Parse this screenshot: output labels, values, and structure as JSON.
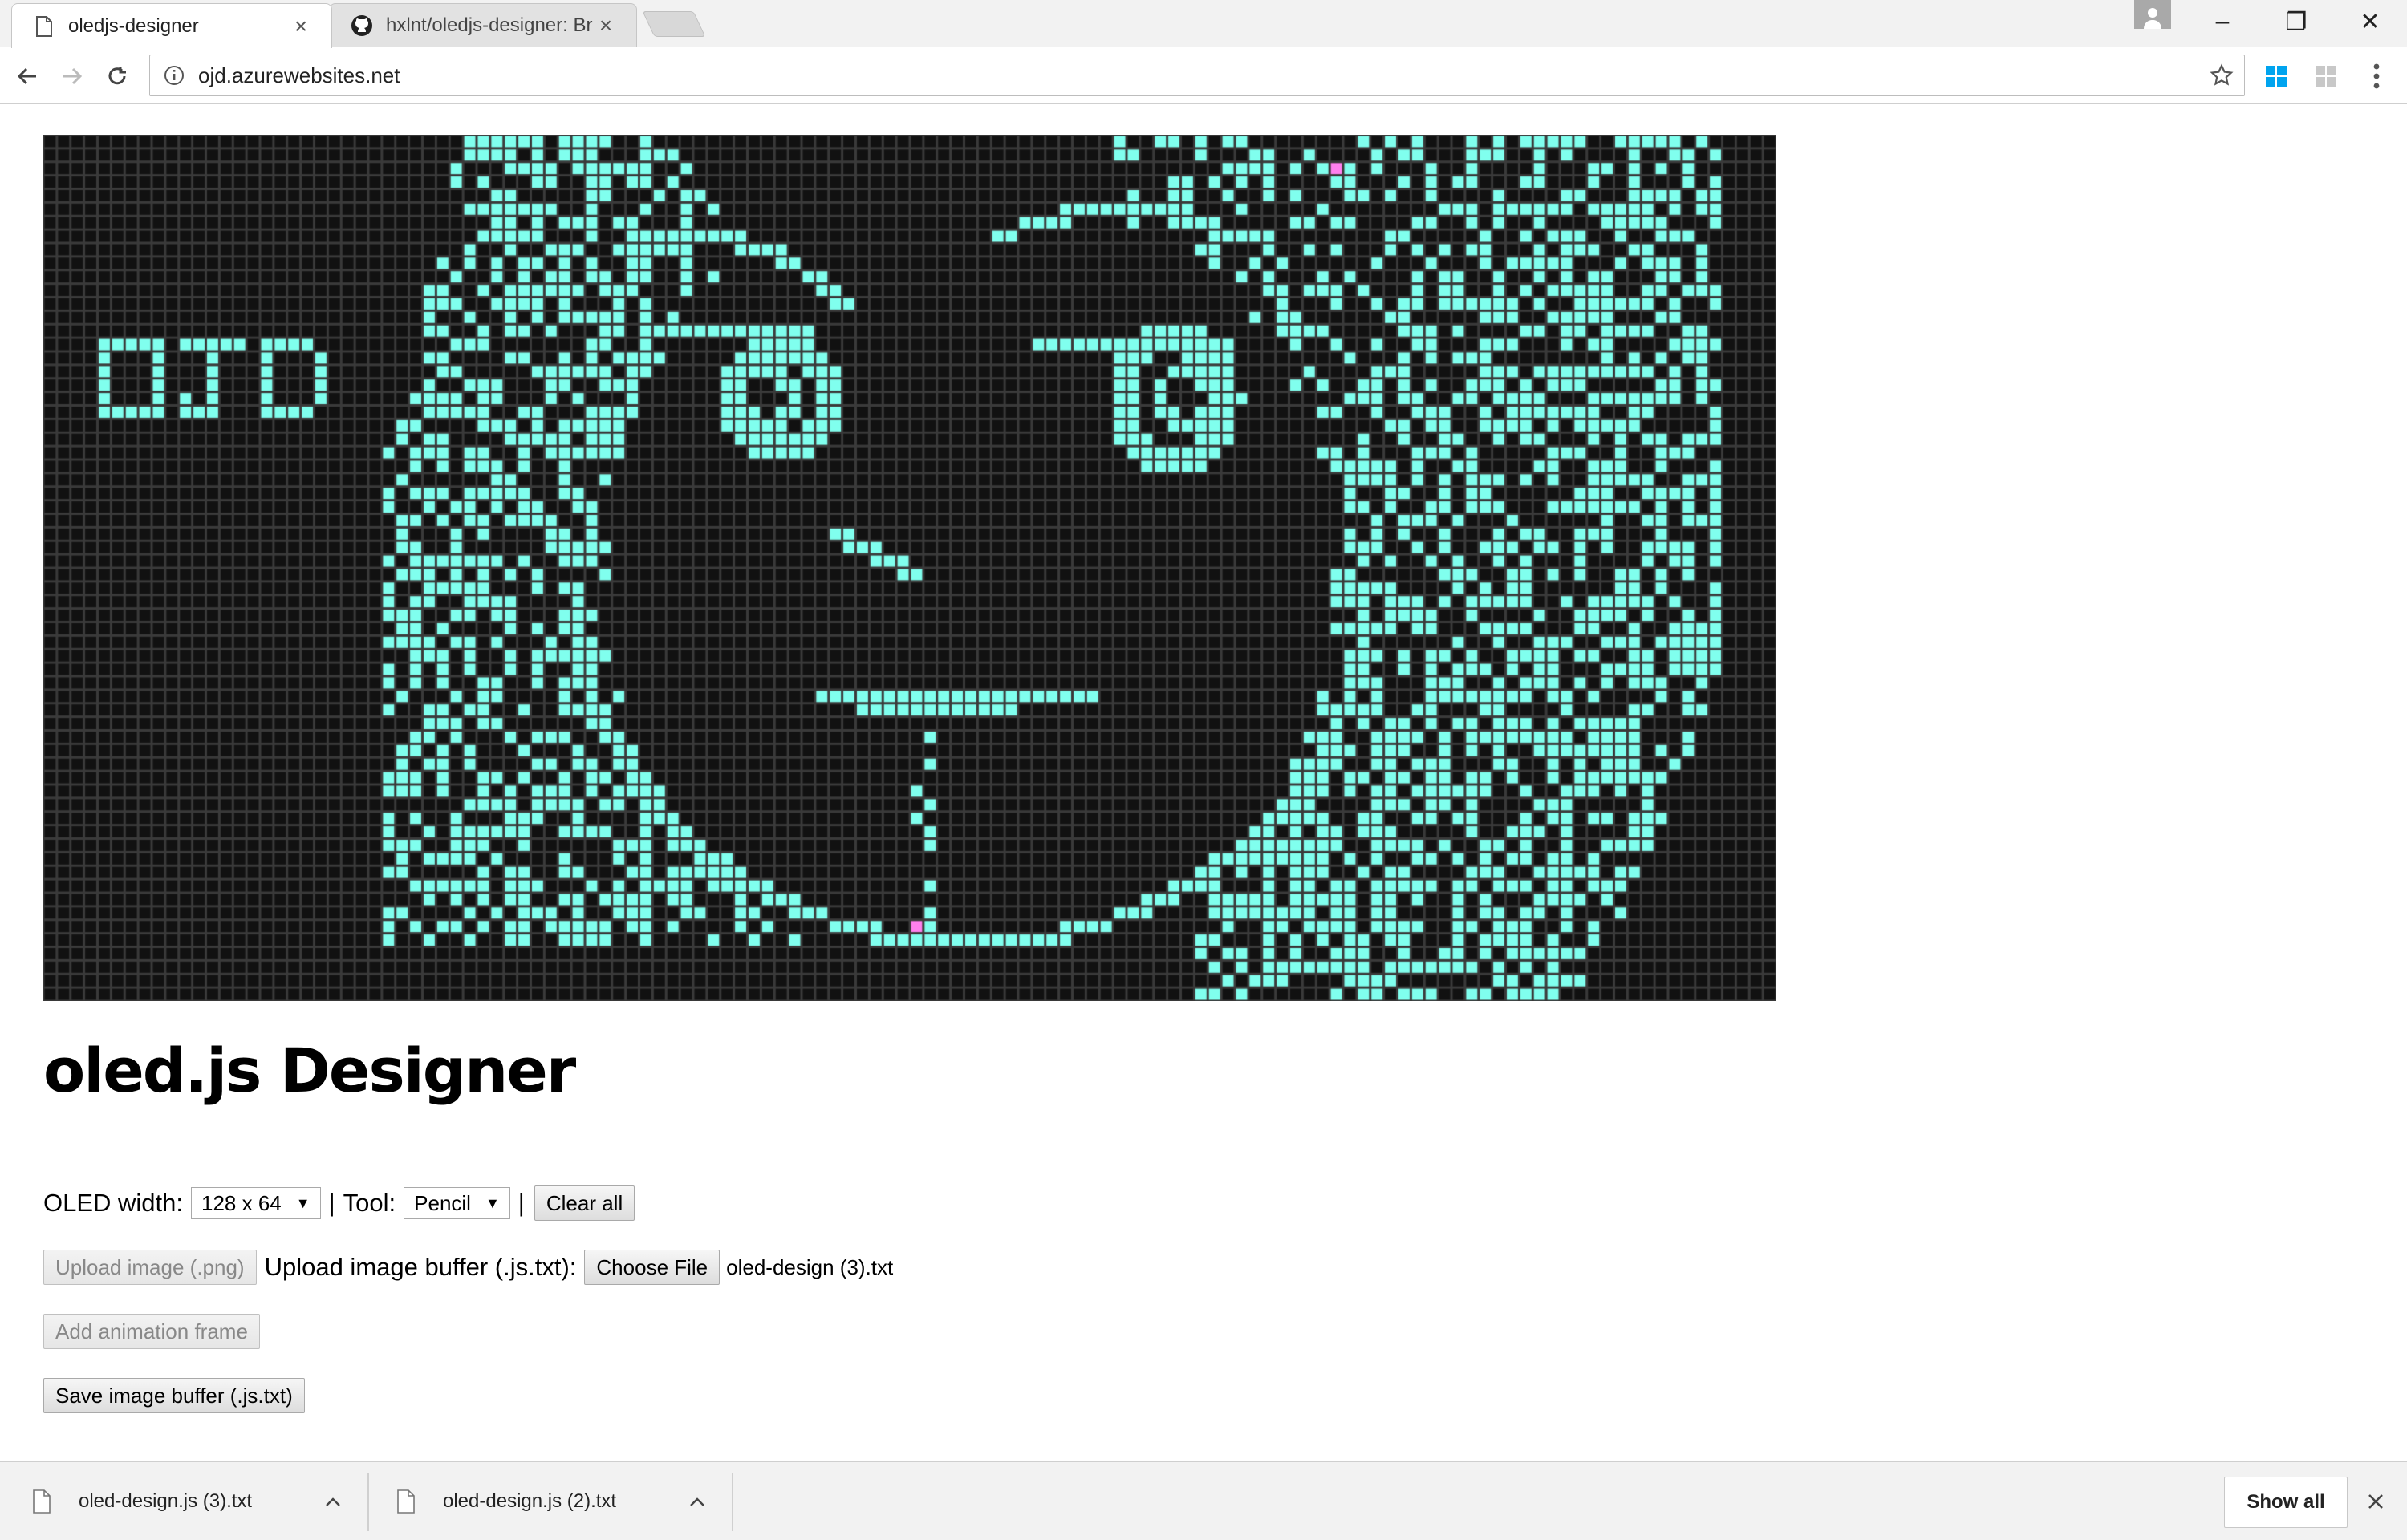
{
  "browser": {
    "tabs": [
      {
        "title": "oledjs-designer",
        "close": "×",
        "active": true
      },
      {
        "title": "hxlnt/oledjs-designer: Br",
        "close": "×",
        "active": false
      }
    ],
    "window_controls": {
      "minimize": "–",
      "restore": "❐",
      "close": "✕"
    },
    "address_bar": {
      "url": "ojd.azurewebsites.net"
    }
  },
  "page": {
    "title": "oled.js Designer",
    "oled_canvas": {
      "pixel_color": "#80ffee",
      "grid_color": "#3a3a3a",
      "off_color": "#111111",
      "highlight_color": "#ff80ee",
      "columns": 128,
      "rows": 64,
      "logo_text": "OJD"
    },
    "controls": {
      "width_label": "OLED width:",
      "width_value": "128 x 64",
      "separator": "|",
      "tool_label": "Tool:",
      "tool_value": "Pencil",
      "clear_all": "Clear all",
      "upload_png": "Upload image (.png)",
      "upload_buffer_label": "Upload image buffer (.js.txt):",
      "choose_file": "Choose File",
      "chosen_file": "oled-design (3).txt",
      "add_frame": "Add animation frame",
      "save_buffer": "Save image buffer (.js.txt)"
    }
  },
  "downloads": {
    "items": [
      {
        "name": "oled-design.js (3).txt"
      },
      {
        "name": "oled-design.js (2).txt"
      }
    ],
    "show_all": "Show all"
  }
}
